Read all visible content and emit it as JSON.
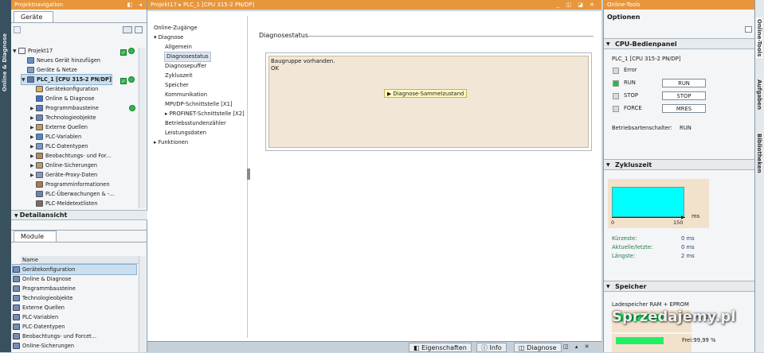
{
  "left_strip": {
    "label": "Online & Diagnose"
  },
  "project_nav": {
    "title": "Projektnavigation",
    "tab": "Geräte",
    "tree": [
      {
        "label": "Projekt17",
        "level": 0,
        "exp": "▼"
      },
      {
        "label": "Neues Gerät hinzufügen",
        "level": 1,
        "exp": ""
      },
      {
        "label": "Geräte & Netze",
        "level": 1,
        "exp": ""
      },
      {
        "label": "PLC_1 [CPU 315-2 PN/DP]",
        "level": 1,
        "exp": "▼"
      },
      {
        "label": "Gerätekonfiguration",
        "level": 2,
        "exp": ""
      },
      {
        "label": "Online & Diagnose",
        "level": 2,
        "exp": ""
      },
      {
        "label": "Programmbausteine",
        "level": 2,
        "exp": "▶"
      },
      {
        "label": "Technologieobjekte",
        "level": 2,
        "exp": "▶"
      },
      {
        "label": "Externe Quellen",
        "level": 2,
        "exp": "▶"
      },
      {
        "label": "PLC-Variablen",
        "level": 2,
        "exp": "▶"
      },
      {
        "label": "PLC-Datentypen",
        "level": 2,
        "exp": "▶"
      },
      {
        "label": "Beobachtungs- und For...",
        "level": 2,
        "exp": "▶"
      },
      {
        "label": "Online-Sicherungen",
        "level": 2,
        "exp": "▶"
      },
      {
        "label": "Geräte-Proxy-Daten",
        "level": 2,
        "exp": "▶"
      },
      {
        "label": "Programminformationen",
        "level": 2,
        "exp": ""
      },
      {
        "label": "PLC-Überwachungen & -...",
        "level": 2,
        "exp": ""
      },
      {
        "label": "PLC-Meldetextlisten",
        "level": 2,
        "exp": ""
      }
    ]
  },
  "detail_view": {
    "title": "Detailansicht",
    "tab": "Module",
    "column": "Name",
    "items": [
      "Gerätekonfiguration",
      "Online & Diagnose",
      "Programmbausteine",
      "Technologieobjekte",
      "Externe Quellen",
      "PLC-Variablen",
      "PLC-Datentypen",
      "Beobachtungs- und Forcet...",
      "Online-Sicherungen"
    ]
  },
  "main": {
    "breadcrumb": "Projekt17 ▸ PLC_1 [CPU 315-2 PN/DP]",
    "menu": [
      {
        "label": "Online-Zugänge",
        "sub": false
      },
      {
        "label": "▾ Diagnose",
        "sub": false
      },
      {
        "label": "Allgemein",
        "sub": true
      },
      {
        "label": "Diagnosestatus",
        "sub": true,
        "selected": true
      },
      {
        "label": "Diagnosepuffer",
        "sub": true
      },
      {
        "label": "Zykluszeit",
        "sub": true
      },
      {
        "label": "Speicher",
        "sub": true
      },
      {
        "label": "Kommunikation",
        "sub": true
      },
      {
        "label": "MPI/DP-Schnittstelle [X1]",
        "sub": true
      },
      {
        "label": "▸ PROFINET-Schnittstelle [X2]",
        "sub": true
      },
      {
        "label": "Betriebsstundenzähler",
        "sub": true
      },
      {
        "label": "Leistungsdaten",
        "sub": true
      },
      {
        "label": "▸ Funktionen",
        "sub": false
      }
    ],
    "section_title": "Diagnosestatus",
    "status_line1": "Baugruppe vorhanden.",
    "status_line2": "OK",
    "tooltip": "Diagnose-Sammelzustand",
    "bottom_tabs": {
      "properties": "Eigenschaften",
      "info": "Info",
      "diagnose": "Diagnose"
    }
  },
  "online_tools": {
    "title": "Online-Tools",
    "options": "Optionen",
    "cpu_panel": {
      "title": "CPU-Bedienpanel",
      "device": "PLC_1 [CPU 315-2 PN/DP]",
      "rows": [
        {
          "label": "Error",
          "led": "#d9d9d9",
          "button": ""
        },
        {
          "label": "RUN",
          "led": "#2eb84a",
          "button": "RUN"
        },
        {
          "label": "STOP",
          "led": "#d9d9d9",
          "button": "STOP"
        },
        {
          "label": "FORCE",
          "led": "#d9d9d9",
          "button": "MRES"
        }
      ],
      "mode_switch": "Betriebsartenschalter:",
      "mode_value": "RUN"
    },
    "cycle": {
      "title": "Zykluszeit",
      "unit": "ms",
      "tick_0": "0",
      "tick_150": "150",
      "rows": [
        {
          "label": "Kürzeste:",
          "value": "0 ms"
        },
        {
          "label": "Aktuelle/letzte:",
          "value": "0 ms"
        },
        {
          "label": "Längste:",
          "value": "2 ms"
        }
      ]
    },
    "memory": {
      "title": "Speicher",
      "label": "Ladespeicher RAM + EPROM",
      "free1": "Frei:99,72 %",
      "free2": "Frei:99,99 %"
    }
  },
  "right_strip": {
    "tab1": "Online-Tools",
    "tab2": "Aufgaben",
    "tab3": "Bibliotheken"
  },
  "watermark": "Sprzedajemy.pl"
}
